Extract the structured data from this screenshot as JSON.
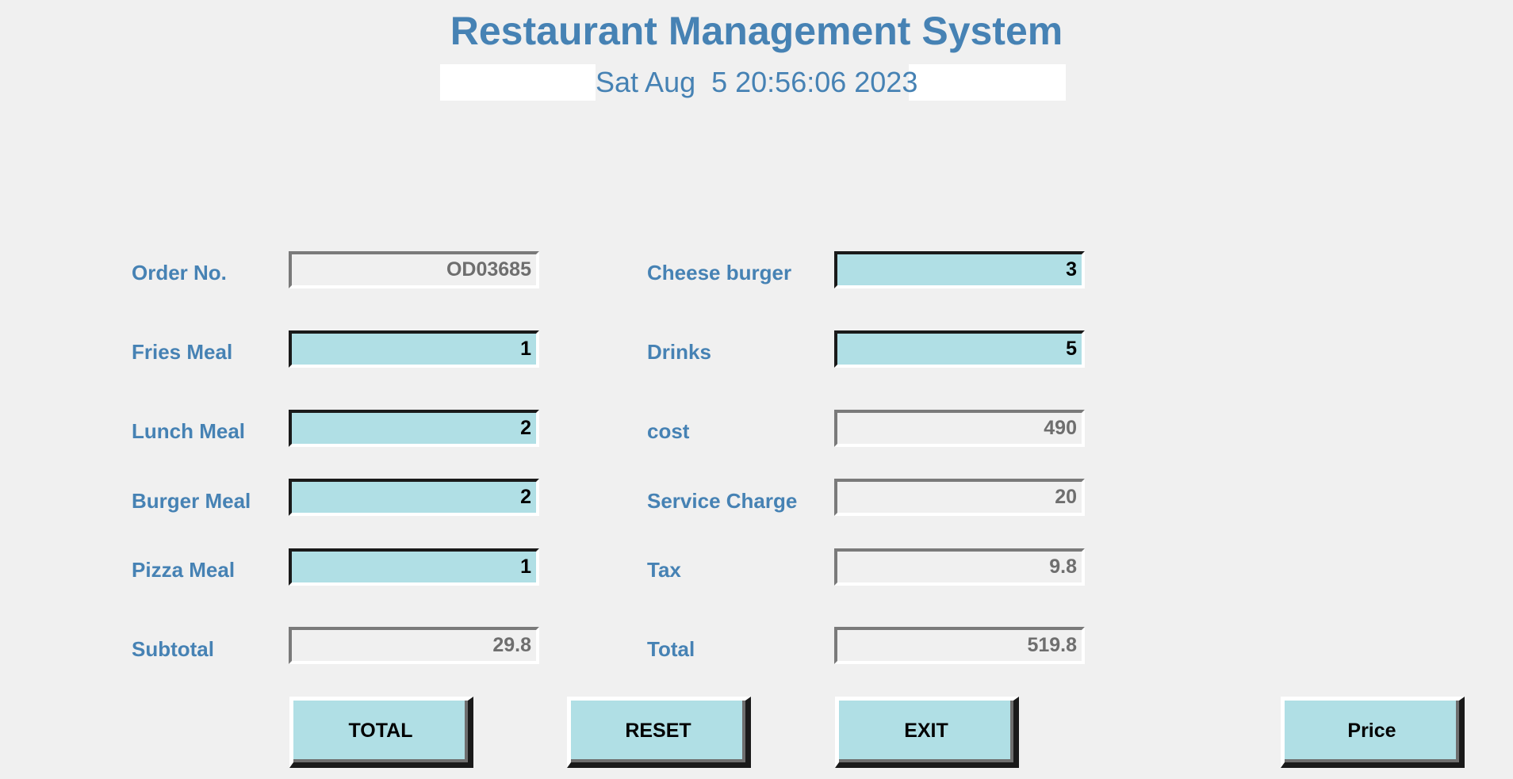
{
  "header": {
    "title": "Restaurant Management System",
    "datetime": "Sat Aug  5 20:56:06 2023"
  },
  "form": {
    "order_no": {
      "label": "Order No.",
      "value": "OD03685"
    },
    "fries_meal": {
      "label": "Fries Meal",
      "value": "1"
    },
    "lunch_meal": {
      "label": "Lunch Meal",
      "value": "2"
    },
    "burger_meal": {
      "label": "Burger Meal",
      "value": "2"
    },
    "pizza_meal": {
      "label": "Pizza Meal",
      "value": "1"
    },
    "subtotal": {
      "label": "Subtotal",
      "value": "29.8"
    },
    "cheese_burger": {
      "label": "Cheese burger",
      "value": "3"
    },
    "drinks": {
      "label": "Drinks",
      "value": "5"
    },
    "cost": {
      "label": "cost",
      "value": "490"
    },
    "service_charge": {
      "label": "Service Charge",
      "value": "20"
    },
    "tax": {
      "label": "Tax",
      "value": "9.8"
    },
    "total": {
      "label": "Total",
      "value": "519.8"
    }
  },
  "buttons": {
    "total": "TOTAL",
    "reset": "RESET",
    "exit": "EXIT",
    "price": "Price"
  },
  "colors": {
    "accent": "#4682b4",
    "field_editable": "#b0dfe5",
    "background": "#f0f0f0"
  }
}
